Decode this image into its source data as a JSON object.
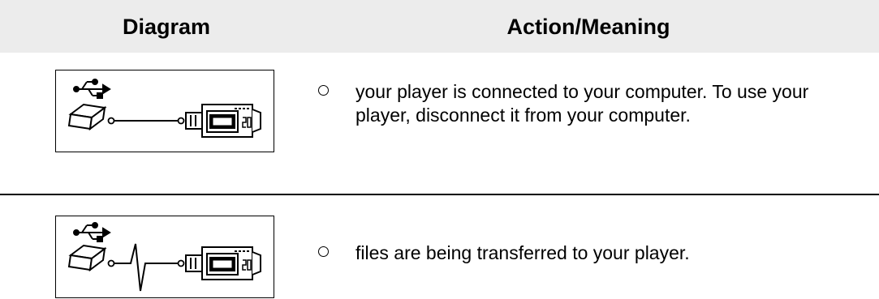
{
  "table": {
    "headers": {
      "diagram": "Diagram",
      "action": "Action/Meaning"
    },
    "rows": [
      {
        "diagram_icon": "usb-connected-icon",
        "text": "your player is connected to your computer. To use your player, disconnect it from your computer."
      },
      {
        "diagram_icon": "usb-transferring-icon",
        "text": "files are being transferred to your player."
      }
    ]
  },
  "colors": {
    "header_background": "#ececec",
    "text": "#000000"
  }
}
